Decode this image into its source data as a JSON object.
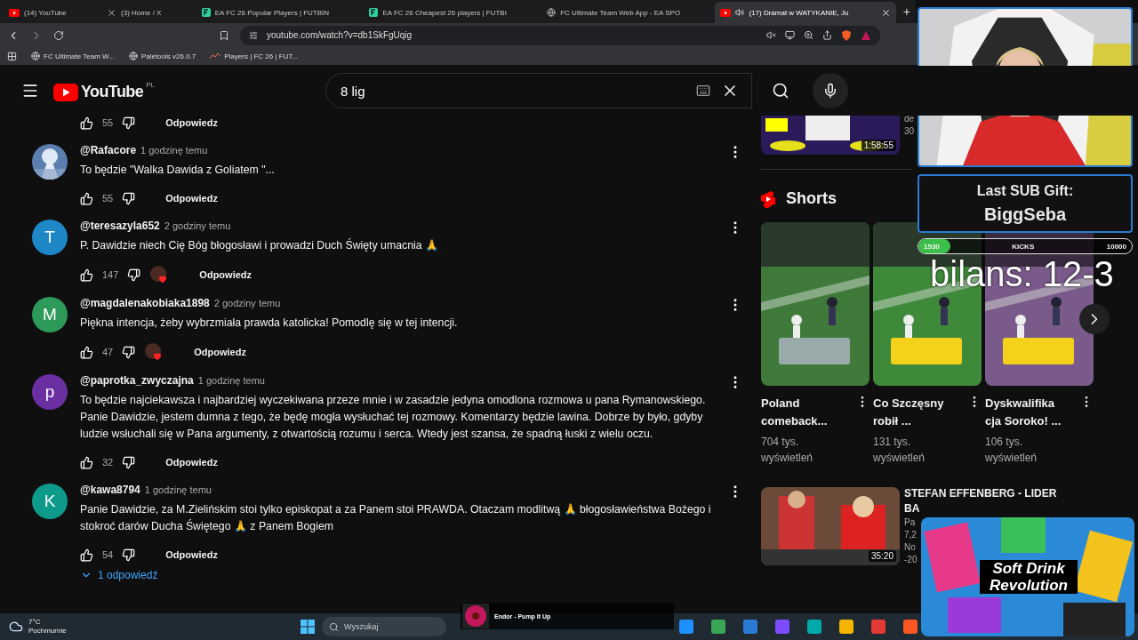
{
  "browser": {
    "tabs": [
      {
        "kind": "youtube",
        "title": "(14) YouTube",
        "selected": false
      },
      {
        "kind": "x",
        "title": "(3) Home / X",
        "selected": false
      },
      {
        "kind": "futbin",
        "title": "EA FC 26 Popular Players | FUTBIN",
        "selected": false
      },
      {
        "kind": "futbin",
        "title": "EA FC 26 Cheapest 26 players | FUTBI",
        "selected": false
      },
      {
        "kind": "globe",
        "title": "FC Ultimate Team Web App - EA SPO",
        "selected": false
      },
      {
        "kind": "youtube",
        "title": "(17) Dramat w WATYKANIE, Ju",
        "selected": true
      }
    ],
    "new_tab": "+",
    "url": "youtube.com/watch?v=db1SkFgUqig",
    "bookmarks": [
      {
        "kind": "globe",
        "label": "FC Ultimate Team W..."
      },
      {
        "kind": "globe",
        "label": "Paletools v26.0.7"
      },
      {
        "kind": "chart",
        "label": "Players | FC 26 | FUT..."
      }
    ]
  },
  "header": {
    "logo": "YouTube",
    "region": "PL",
    "search": {
      "value": "8 lig"
    }
  },
  "comments": [
    {
      "likes": "55",
      "hearted": false,
      "reply": "Odpowiedz",
      "avatar": {
        "kind": "none"
      }
    },
    {
      "author": "@Rafacore",
      "time": "1 godzinę temu",
      "text": "To będzie \"Walka Dawida z Goliatem \"...",
      "likes": "55",
      "hearted": false,
      "reply": "Odpowiedz"
    },
    {
      "author": "@teresazyla652",
      "time": "2 godziny temu",
      "text": "P. Dawidzie niech Cię Bóg błogosławi i prowadzi Duch Święty umacnia 🙏",
      "likes": "147",
      "hearted": true,
      "reply": "Odpowiedz",
      "avatar": {
        "kind": "letter",
        "letter": "T",
        "color": "#1e88c7"
      }
    },
    {
      "author": "@magdalenakobiaka1898",
      "time": "2 godziny temu",
      "text": "Piękna intencja, żeby wybrzmiała prawda katolicka! Pomodlę się w tej intencji.",
      "likes": "47",
      "hearted": true,
      "reply": "Odpowiedz",
      "avatar": {
        "kind": "letter",
        "letter": "M",
        "color": "#2e9a5a"
      }
    },
    {
      "author": "@paprotka_zwyczajna",
      "time": "1 godzinę temu",
      "text": "To będzie najciekawsza i najbardziej wyczekiwana przeze mnie i w zasadzie jedyna omodlona rozmowa u pana Rymanowskiego. Panie Dawidzie, jestem dumna z tego, że będę mogła wysłuchać tej rozmowy. Komentarzy będzie lawina. Dobrze by było, gdyby ludzie wsłuchali się w Pana argumenty, z otwartością rozumu i serca. Wtedy jest szansa, że spadną łuski z wielu oczu.",
      "likes": "32",
      "hearted": false,
      "reply": "Odpowiedz",
      "avatar": {
        "kind": "letter",
        "letter": "p",
        "color": "#6a2fa0"
      }
    },
    {
      "author": "@kawa8794",
      "time": "1 godzinę temu",
      "text": "Panie Dawidzie, za M.Zielińskim stoi tylko episkopat a za Panem stoi PRAWDA. Otaczam modlitwą 🙏  błogosławieństwa Bożego i stokroć darów Ducha Świętego 🙏  z Panem Bogiem",
      "likes": "54",
      "hearted": false,
      "reply": "Odpowiedz",
      "avatar": {
        "kind": "letter",
        "letter": "K",
        "color": "#0e9a8a"
      }
    }
  ],
  "replies_link": "1 odpowiedź",
  "sidebar": {
    "top_video": {
      "duration": "1:58:55",
      "meta": [
        "de",
        "30"
      ]
    },
    "shorts_title": "Shorts",
    "shorts": [
      {
        "title": "Poland comeback...",
        "views": "704 tys. wyświetleń"
      },
      {
        "title": "Co Szczęsny robił ...",
        "views": "131 tys. wyświetleń"
      },
      {
        "title": "Dyskwalifika cja Soroko! ...",
        "views": "106 tys. wyświetleń"
      }
    ],
    "bottom_video": {
      "title": "STEFAN EFFENBERG - LIDER",
      "title_2": "BA",
      "duration": "35:20",
      "meta": [
        "Pa",
        "7,2",
        "No",
        "-20"
      ]
    }
  },
  "overlay": {
    "sub_gift": {
      "label": "Last SUB Gift:",
      "name": "BiggSeba"
    },
    "kicks": {
      "current": "1530",
      "label": "KICKS",
      "goal": "10000",
      "level": 0.15
    },
    "score": "bilans: 12-3",
    "ad": "Soft Drink Revolution",
    "now_playing": {
      "title": "Endor - Pump It Up"
    }
  },
  "taskbar": {
    "weather": {
      "temp": "7°C",
      "desc": "Pochmurnie"
    },
    "search": {
      "placeholder": "Wyszukaj"
    }
  }
}
